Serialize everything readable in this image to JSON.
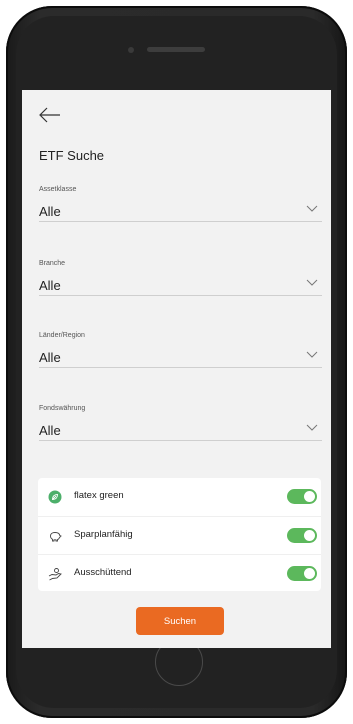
{
  "page": {
    "title": "ETF Suche"
  },
  "fields": [
    {
      "label": "Assetklasse",
      "value": "Alle"
    },
    {
      "label": "Branche",
      "value": "Alle"
    },
    {
      "label": "Länder/Region",
      "value": "Alle"
    },
    {
      "label": "Fondswährung",
      "value": "Alle"
    }
  ],
  "toggles": [
    {
      "label": "flatex green",
      "icon": "leaf-icon",
      "on": true
    },
    {
      "label": "Sparplanfähig",
      "icon": "piggy-bank-icon",
      "on": true
    },
    {
      "label": "Ausschüttend",
      "icon": "hand-coin-icon",
      "on": true
    }
  ],
  "actions": {
    "search_label": "Suchen"
  },
  "colors": {
    "accent": "#ea6a22",
    "toggle_on": "#5cb85c",
    "background": "#f2f2f2"
  }
}
